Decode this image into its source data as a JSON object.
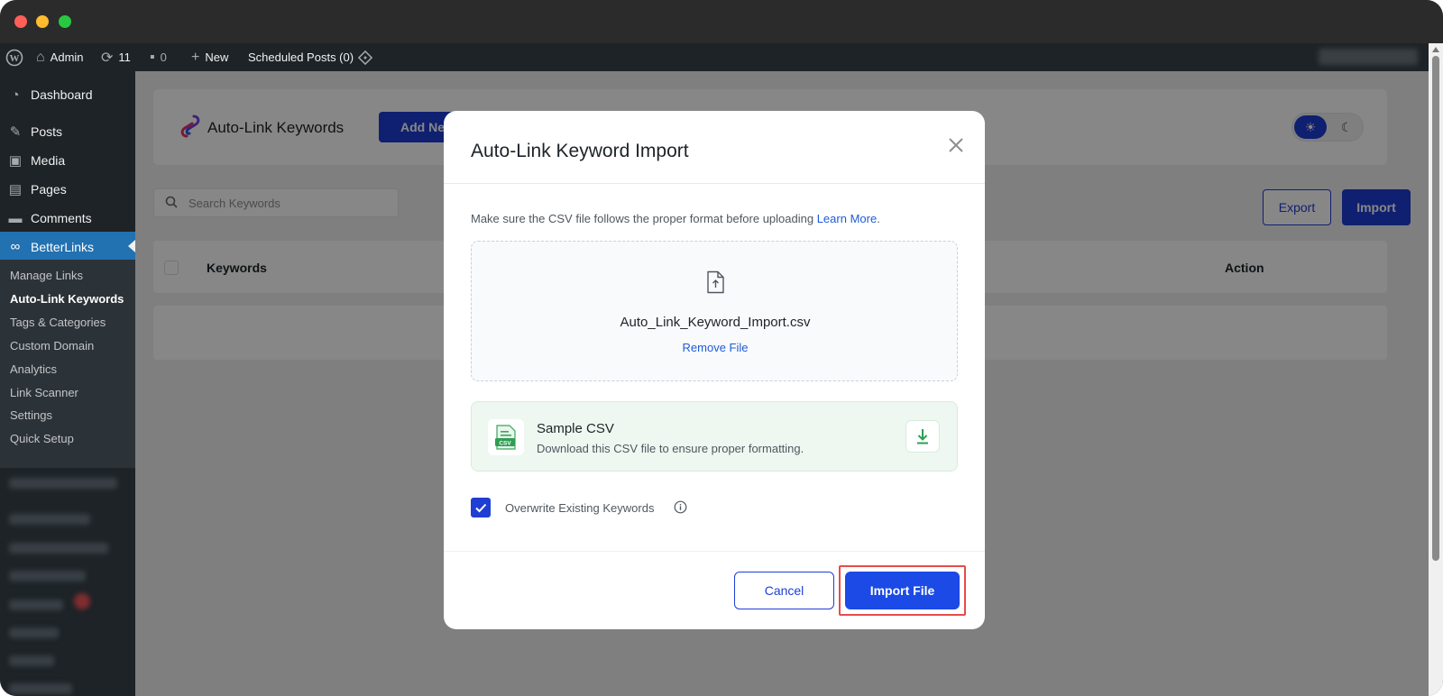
{
  "admin_bar": {
    "site_name": "Admin",
    "updates_count": "11",
    "comments_count": "0",
    "new_label": "New",
    "scheduled_posts": "Scheduled Posts (0)"
  },
  "sidebar": {
    "items": [
      {
        "label": "Dashboard"
      },
      {
        "label": "Posts"
      },
      {
        "label": "Media"
      },
      {
        "label": "Pages"
      },
      {
        "label": "Comments"
      },
      {
        "label": "BetterLinks"
      }
    ],
    "submenu": [
      {
        "label": "Manage Links"
      },
      {
        "label": "Auto-Link Keywords"
      },
      {
        "label": "Tags & Categories"
      },
      {
        "label": "Custom Domain"
      },
      {
        "label": "Analytics"
      },
      {
        "label": "Link Scanner"
      },
      {
        "label": "Settings"
      },
      {
        "label": "Quick Setup"
      }
    ]
  },
  "page": {
    "title": "Auto-Link Keywords",
    "add_new_label": "Add New",
    "search_placeholder": "Search Keywords",
    "export_label": "Export",
    "import_label": "Import",
    "table_columns": {
      "keywords": "Keywords",
      "action": "Action"
    }
  },
  "modal": {
    "title": "Auto-Link Keyword Import",
    "note": "Make sure the CSV file follows the proper format before uploading ",
    "learn_more": "Learn More",
    "note_end": ".",
    "file_name": "Auto_Link_Keyword_Import.csv",
    "remove_file": "Remove File",
    "sample_title": "Sample CSV",
    "sample_desc": "Download this CSV file to ensure proper formatting.",
    "csv_badge": "CSV",
    "overwrite_label": "Overwrite Existing Keywords",
    "overwrite_checked": true,
    "cancel_label": "Cancel",
    "import_file_label": "Import File"
  },
  "colors": {
    "primary": "#1e3ed4",
    "wp_admin_bg": "#1d2327",
    "wp_active": "#2271b1",
    "highlight": "#e94b4b",
    "sample_bg": "#eef8f1"
  },
  "icons": [
    "wordpress-icon",
    "home-icon",
    "updates-icon",
    "comments-icon",
    "plus-icon",
    "diamond-icon",
    "dashboard-icon",
    "pin-icon",
    "media-icon",
    "pages-icon",
    "comment-icon",
    "link-icon",
    "search-icon",
    "sun-icon",
    "moon-icon",
    "close-icon",
    "file-upload-icon",
    "csv-file-icon",
    "download-icon",
    "checkmark-icon",
    "info-icon"
  ]
}
